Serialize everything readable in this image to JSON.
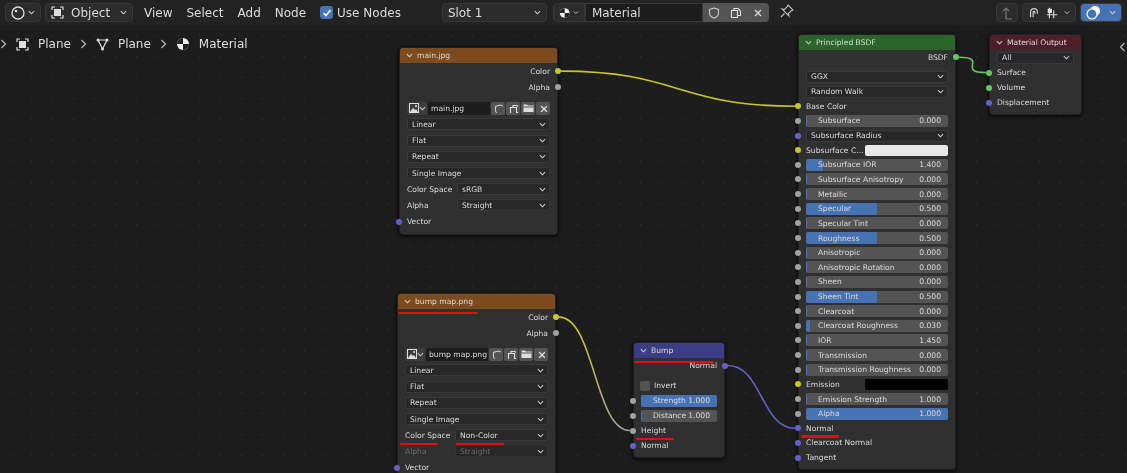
{
  "header": {
    "mode": "Object",
    "menus": [
      "View",
      "Select",
      "Add",
      "Node"
    ],
    "use_nodes": {
      "label": "Use Nodes",
      "checked": true
    },
    "slot": "Slot 1",
    "material": "Material"
  },
  "breadcrumbs": [
    "Plane",
    "Plane",
    "Material"
  ],
  "nodes": [
    {
      "kind": "image",
      "title": "main.jpg",
      "title_underlined": false,
      "rows": [
        {
          "kind": "output",
          "label": "Color",
          "socket": {
            "color": "#c7c729"
          }
        },
        {
          "kind": "output",
          "label": "Alpha",
          "socket": {
            "color": "#a1a1a1"
          }
        },
        {
          "kind": "image",
          "value": "main.jpg"
        },
        {
          "kind": "select",
          "value": "Linear"
        },
        {
          "kind": "select",
          "value": "Flat"
        },
        {
          "kind": "select",
          "value": "Repeat"
        },
        {
          "kind": "select",
          "value": "Single Image"
        },
        {
          "kind": "field",
          "label": "Color Space",
          "value": "sRGB",
          "disabled": false
        },
        {
          "kind": "field",
          "label": "Alpha",
          "value": "Straight",
          "disabled": false
        },
        {
          "kind": "input",
          "label": "Vector",
          "socket": {
            "color": "#6363c7"
          }
        }
      ]
    },
    {
      "kind": "image",
      "title": "bump map.png",
      "title_underlined": true,
      "rows": [
        {
          "kind": "output",
          "label": "Color",
          "socket": {
            "color": "#c7c729"
          }
        },
        {
          "kind": "output",
          "label": "Alpha",
          "socket": {
            "color": "#a1a1a1"
          }
        },
        {
          "kind": "image",
          "value": "bump map.png"
        },
        {
          "kind": "select",
          "value": "Linear"
        },
        {
          "kind": "select",
          "value": "Flat"
        },
        {
          "kind": "select",
          "value": "Repeat"
        },
        {
          "kind": "select",
          "value": "Single Image"
        },
        {
          "kind": "field",
          "label": "Color Space",
          "value": "Non-Color",
          "disabled": false,
          "underlined": true
        },
        {
          "kind": "field",
          "label": "Alpha",
          "value": "Straight",
          "disabled": true
        },
        {
          "kind": "input",
          "label": "Vector",
          "socket": {
            "color": "#6363c7"
          }
        }
      ]
    },
    {
      "kind": "bump",
      "title": "Bump",
      "title_underlined": true,
      "rows": [
        {
          "kind": "output",
          "label": "Normal",
          "socket": {
            "color": "#6363c7"
          }
        },
        {
          "kind": "checkbox",
          "label": "Invert",
          "checked": false
        },
        {
          "kind": "slider",
          "label": "Strength",
          "value": "1.000",
          "level": 1,
          "socket": {
            "color": "#a1a1a1"
          }
        },
        {
          "kind": "slider",
          "label": "Distance",
          "value": "1.000",
          "level": 0,
          "socket": {
            "color": "#a1a1a1"
          }
        },
        {
          "kind": "input",
          "label": "Height",
          "socket": {
            "color": "#a1a1a1"
          },
          "underlined": true
        },
        {
          "kind": "input",
          "label": "Normal",
          "socket": {
            "color": "#6363c7"
          }
        }
      ]
    },
    {
      "kind": "bsdf",
      "title": "Principled BSDF",
      "title_underlined": false,
      "rows": [
        {
          "kind": "output",
          "label": "BSDF",
          "socket": {
            "color": "#63c763"
          }
        },
        {
          "kind": "select",
          "value": "GGX"
        },
        {
          "kind": "select",
          "value": "Random Walk"
        },
        {
          "kind": "input",
          "label": "Base Color",
          "socket": {
            "color": "#c7c729"
          }
        },
        {
          "kind": "slider",
          "label": "Subsurface",
          "value": "0.000",
          "level": 0,
          "socket": {
            "color": "#a1a1a1"
          }
        },
        {
          "kind": "select",
          "value": "Subsurface Radius",
          "socket": {
            "color": "#6363c7"
          }
        },
        {
          "kind": "swatch",
          "label": "Subsurface C...",
          "color": "#e8e8e8",
          "socket": {
            "color": "#c7c729"
          }
        },
        {
          "kind": "slider",
          "label": "Subsurface IOR",
          "value": "1.400",
          "level": 0.12,
          "socket": {
            "color": "#a1a1a1"
          }
        },
        {
          "kind": "slider",
          "label": "Subsurface Anisotropy",
          "value": "0.000",
          "level": 0,
          "socket": {
            "color": "#a1a1a1"
          }
        },
        {
          "kind": "slider",
          "label": "Metallic",
          "value": "0.000",
          "level": 0,
          "socket": {
            "color": "#a1a1a1"
          }
        },
        {
          "kind": "slider",
          "label": "Specular",
          "value": "0.500",
          "level": 0.5,
          "socket": {
            "color": "#a1a1a1"
          }
        },
        {
          "kind": "slider",
          "label": "Specular Tint",
          "value": "0.000",
          "level": 0,
          "socket": {
            "color": "#a1a1a1"
          }
        },
        {
          "kind": "slider",
          "label": "Roughness",
          "value": "0.500",
          "level": 0.5,
          "socket": {
            "color": "#a1a1a1"
          }
        },
        {
          "kind": "slider",
          "label": "Anisotropic",
          "value": "0.000",
          "level": 0,
          "socket": {
            "color": "#a1a1a1"
          }
        },
        {
          "kind": "slider",
          "label": "Anisotropic Rotation",
          "value": "0.000",
          "level": 0,
          "socket": {
            "color": "#a1a1a1"
          }
        },
        {
          "kind": "slider",
          "label": "Sheen",
          "value": "0.000",
          "level": 0,
          "socket": {
            "color": "#a1a1a1"
          }
        },
        {
          "kind": "slider",
          "label": "Sheen Tint",
          "value": "0.500",
          "level": 0.5,
          "socket": {
            "color": "#a1a1a1"
          }
        },
        {
          "kind": "slider",
          "label": "Clearcoat",
          "value": "0.000",
          "level": 0,
          "socket": {
            "color": "#a1a1a1"
          }
        },
        {
          "kind": "slider",
          "label": "Clearcoat Roughness",
          "value": "0.030",
          "level": 0.03,
          "socket": {
            "color": "#a1a1a1"
          }
        },
        {
          "kind": "slider",
          "label": "IOR",
          "value": "1.450",
          "level": 0,
          "socket": {
            "color": "#a1a1a1"
          }
        },
        {
          "kind": "slider",
          "label": "Transmission",
          "value": "0.000",
          "level": 0,
          "socket": {
            "color": "#a1a1a1"
          }
        },
        {
          "kind": "slider",
          "label": "Transmission Roughness",
          "value": "0.000",
          "level": 0,
          "socket": {
            "color": "#a1a1a1"
          }
        },
        {
          "kind": "swatch",
          "label": "Emission",
          "color": "#000000",
          "socket": {
            "color": "#c7c729"
          }
        },
        {
          "kind": "slider",
          "label": "Emission Strength",
          "value": "1.000",
          "level": 0,
          "socket": {
            "color": "#a1a1a1"
          }
        },
        {
          "kind": "slider",
          "label": "Alpha",
          "value": "1.000",
          "level": 1,
          "socket": {
            "color": "#a1a1a1"
          }
        },
        {
          "kind": "input",
          "label": "Normal",
          "socket": {
            "color": "#6363c7"
          },
          "underlined": true
        },
        {
          "kind": "input",
          "label": "Clearcoat Normal",
          "socket": {
            "color": "#6363c7"
          }
        },
        {
          "kind": "input",
          "label": "Tangent",
          "socket": {
            "color": "#6363c7"
          }
        }
      ]
    },
    {
      "kind": "output",
      "title": "Material Output",
      "title_underlined": false,
      "rows": [
        {
          "kind": "select",
          "value": "All"
        },
        {
          "kind": "input",
          "label": "Surface",
          "socket": {
            "color": "#63c763"
          }
        },
        {
          "kind": "input",
          "label": "Volume",
          "socket": {
            "color": "#63c763"
          }
        },
        {
          "kind": "input",
          "label": "Displacement",
          "socket": {
            "color": "#6363c7"
          }
        }
      ]
    }
  ]
}
